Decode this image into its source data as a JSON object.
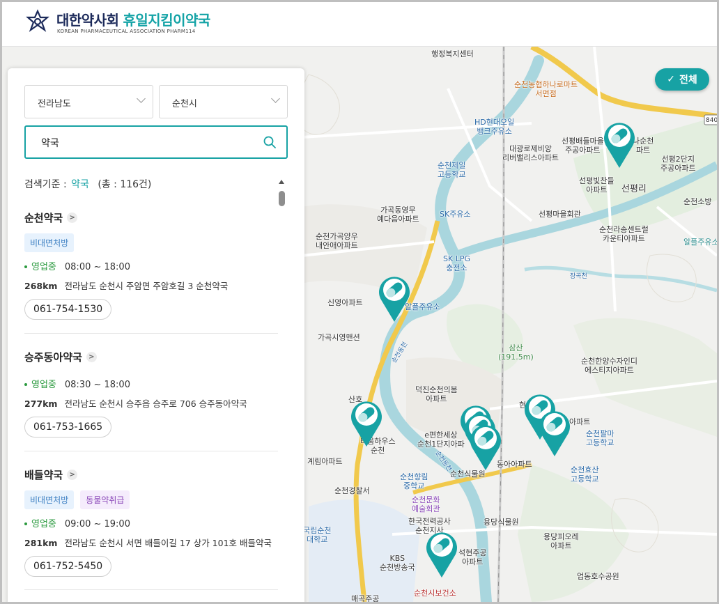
{
  "header": {
    "title_main": "대한약사회",
    "title_sub": "휴일지킴이약국",
    "subtitle": "KOREAN PHARMACEUTICAL ASSOCIATION PHARM114"
  },
  "filters": {
    "province": "전라남도",
    "city": "순천시",
    "search_value": "약국"
  },
  "results": {
    "criteria_label": "검색기준 :",
    "keyword": "약국",
    "count_text": "(총 : 116건)",
    "items": [
      {
        "name": "순천약국",
        "badges": [
          "비대면처방"
        ],
        "status": "영업중",
        "hours": "08:00 ~ 18:00",
        "distance": "268km",
        "address": "전라남도 순천시 주암면 주암호길 3 순천약국",
        "phone": "061-754-1530"
      },
      {
        "name": "승주동아약국",
        "badges": [],
        "status": "영업중",
        "hours": "08:30 ~ 18:00",
        "distance": "277km",
        "address": "전라남도 순천시 승주읍 승주로 706 승주동아약국",
        "phone": "061-753-1665"
      },
      {
        "name": "배들약국",
        "badges": [
          "비대면처방",
          "동물약취급"
        ],
        "status": "영업중",
        "hours": "09:00 ~ 19:00",
        "distance": "281km",
        "address": "전라남도 순천시 서면 배들이길 17 상가 101호 배들약국",
        "phone": "061-752-5450"
      }
    ]
  },
  "map": {
    "all_button": "전체",
    "labels": {
      "l1": "행정복지센터",
      "l2": "순천농협하나로마트",
      "l2b": "서면점",
      "l3": "HD현대오일",
      "l3b": "뱅크주유소",
      "l4": "대광로제비앙",
      "l4b": "리버밸리스아파트",
      "l5": "선평배들마을",
      "l5b": "주공아파트",
      "l6": "나순천",
      "l6b": "파트",
      "l7": "순천제일",
      "l7b": "고등학교",
      "l8": "선평빛찬들",
      "l8b": "아파트",
      "l9": "선평리",
      "l10": "선평2단지",
      "l10b": "주공아파트",
      "l11": "가곡동영무",
      "l11b": "예다음아파트",
      "l12": "SK주유소",
      "l13": "선평마을회관",
      "l14": "순천소방",
      "l15": "순천가곡양우",
      "l15b": "내안애아파트",
      "l16": "순천라송센트럴",
      "l16b": "카운티아파트",
      "l17": "알플주유소",
      "l18": "SK LPG",
      "l18b": "충전소",
      "l19": "신영아파트",
      "l20": "알플주유소",
      "l21": "가곡시영맨션",
      "l22": "삼산",
      "l22b": "(191.5m)",
      "l23": "순천한양수자인디",
      "l23b": "에스티지아파트",
      "l24": "덕진순천의봄",
      "l24b": "아파트",
      "l25": "산호",
      "l26": "e편한세상",
      "l26b": "순천1단지아파",
      "l27": "티움하우스",
      "l27b": "순천",
      "l28": "아파트",
      "l29": "순천팔마",
      "l29b": "고등학교",
      "l30": "계림아파트",
      "l31": "순천식물원",
      "l32": "동아아파트",
      "l33": "순천효산",
      "l33b": "고등학교",
      "l34": "순천향림",
      "l34b": "중학교",
      "l35": "순천경찰서",
      "l36": "순천문화",
      "l36b": "예술회관",
      "l37": "한국전력공사",
      "l37b": "순천지사",
      "l38": "용당식물원",
      "l39": "국립순천",
      "l39b": "대학교",
      "l40": "석현주공",
      "l40b": "아파트",
      "l41": "용당피오레",
      "l41b": "아파트",
      "l42": "KBS",
      "l42b": "순천방송국",
      "l43": "업동호수공원",
      "l44": "순천시보건소",
      "l45": "매곡주공",
      "l46": "현",
      "river1": "순천동천",
      "river2": "순천동천",
      "river3": "장곡천",
      "road": "840"
    }
  },
  "colors": {
    "accent": "#17a2a4",
    "navy": "#1c2a5a",
    "open_green": "#2b9a3f"
  }
}
